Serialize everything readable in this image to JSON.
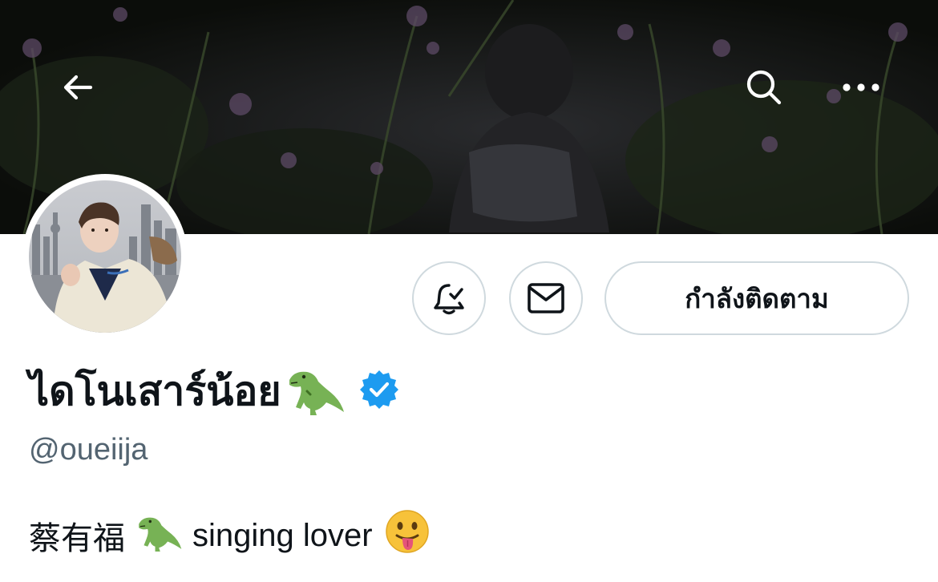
{
  "header": {
    "back_icon": "arrow-left-icon",
    "search_icon": "search-icon",
    "more_icon": "more-horizontal-icon"
  },
  "profile": {
    "display_name": "ไดโนเสาร์น้อย",
    "name_emoji": "t-rex-emoji",
    "verified_icon": "verified-badge-icon",
    "handle": "@oueiija",
    "bio_chinese": "蔡有福",
    "bio_text": "singing lover",
    "bio_emojis": [
      "t-rex-emoji",
      "tongue-out-face-emoji"
    ]
  },
  "actions": {
    "notify_icon": "bell-check-icon",
    "message_icon": "envelope-icon",
    "following_label": "กำลังติดตาม"
  },
  "colors": {
    "text_primary": "#0f1419",
    "text_secondary": "#536471",
    "border": "#cfd9de",
    "verified_blue": "#1d9bf0"
  }
}
